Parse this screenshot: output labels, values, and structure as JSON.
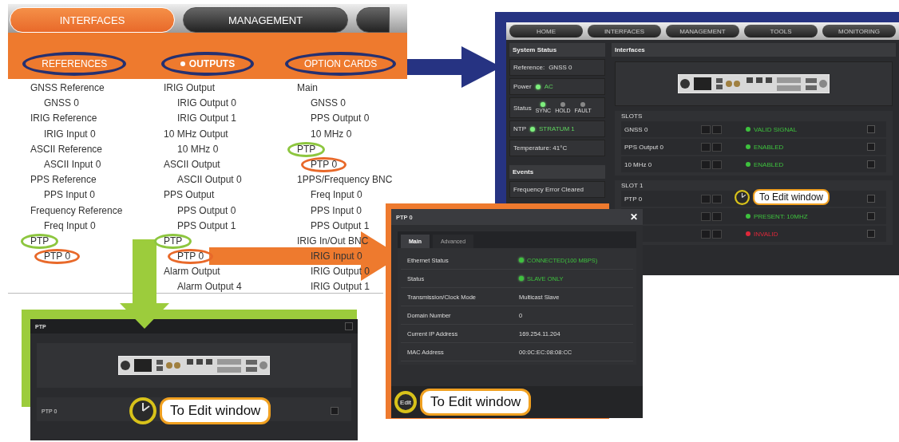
{
  "menu": {
    "tabs": [
      {
        "label": "INTERFACES",
        "selected": true
      },
      {
        "label": "MANAGEMENT",
        "selected": false
      }
    ],
    "categories": [
      {
        "label": "REFERENCES",
        "selected": false
      },
      {
        "label": "OUTPUTS",
        "selected": true
      },
      {
        "label": "OPTION CARDS",
        "selected": false
      }
    ],
    "columns": [
      {
        "items": [
          {
            "label": "GNSS Reference",
            "children": [
              {
                "label": "GNSS 0"
              }
            ]
          },
          {
            "label": "IRIG Reference",
            "children": [
              {
                "label": "IRIG Input 0"
              }
            ]
          },
          {
            "label": "ASCII Reference",
            "children": [
              {
                "label": "ASCII Input 0"
              }
            ]
          },
          {
            "label": "PPS Reference",
            "children": [
              {
                "label": "PPS Input 0"
              }
            ]
          },
          {
            "label": "Frequency Reference",
            "children": [
              {
                "label": "Freq Input 0"
              }
            ]
          },
          {
            "label": "PTP",
            "color": "#8dc63f",
            "children": [
              {
                "label": "PTP 0",
                "color": "#e8692a"
              }
            ]
          }
        ]
      },
      {
        "items": [
          {
            "label": "IRIG Output",
            "children": [
              {
                "label": "IRIG Output 0"
              },
              {
                "label": "IRIG Output 1"
              }
            ]
          },
          {
            "label": "10 MHz Output",
            "children": [
              {
                "label": "10 MHz 0"
              }
            ]
          },
          {
            "label": "ASCII Output",
            "children": [
              {
                "label": "ASCII Output 0"
              }
            ]
          },
          {
            "label": "PPS Output",
            "children": [
              {
                "label": "PPS Output 0"
              },
              {
                "label": "PPS Output 1"
              }
            ]
          },
          {
            "label": "PTP",
            "color": "#8dc63f",
            "children": [
              {
                "label": "PTP 0",
                "color": "#e8692a"
              }
            ]
          },
          {
            "label": "Alarm Output",
            "children": [
              {
                "label": "Alarm Output 4"
              }
            ]
          }
        ]
      },
      {
        "items": [
          {
            "label": "Main",
            "children": [
              {
                "label": "GNSS 0"
              },
              {
                "label": "PPS Output 0"
              },
              {
                "label": "10 MHz 0"
              }
            ]
          },
          {
            "label": "PTP",
            "color": "#8dc63f",
            "children": [
              {
                "label": "PTP 0",
                "color": "#e8692a"
              }
            ]
          },
          {
            "label": "1PPS/Frequency BNC",
            "children": [
              {
                "label": "Freq Input 0"
              },
              {
                "label": "PPS Input 0"
              },
              {
                "label": "PPS Output 1"
              }
            ]
          },
          {
            "label": "IRIG In/Out BNC",
            "children": [
              {
                "label": "IRIG Input 0"
              },
              {
                "label": "IRIG Output 0"
              },
              {
                "label": "IRIG Output 1"
              }
            ]
          }
        ]
      }
    ]
  },
  "dashboard": {
    "nav": [
      "HOME",
      "INTERFACES",
      "MANAGEMENT",
      "TOOLS",
      "MONITORING"
    ],
    "system_status": {
      "title": "System Status",
      "reference_label": "Reference:",
      "reference_value": "GNSS 0",
      "power_label": "Power",
      "power_value": "AC",
      "status_label": "Status",
      "leds": [
        {
          "label": "SYNC",
          "on": true
        },
        {
          "label": "HOLD",
          "on": false
        },
        {
          "label": "FAULT",
          "on": false
        }
      ],
      "ntp_label": "NTP",
      "ntp_value": "STRATUM 1",
      "temperature": "Temperature: 41°C"
    },
    "events": {
      "title": "Events",
      "items": [
        "Frequency Error Cleared"
      ]
    },
    "interfaces": {
      "title": "Interfaces",
      "groups": [
        {
          "label": "SLOTS",
          "rows": [
            {
              "name": "GNSS 0",
              "status": "VALID SIGNAL",
              "color": "#3ec23e"
            },
            {
              "name": "PPS Output 0",
              "status": "ENABLED",
              "color": "#3ec23e"
            },
            {
              "name": "10 MHz 0",
              "status": "ENABLED",
              "color": "#3ec23e"
            }
          ]
        },
        {
          "label": "SLOT 1",
          "rows": [
            {
              "name": "PTP 0"
            },
            {
              "status": "PRESENT: 10MHZ",
              "color": "#3ec23e"
            },
            {
              "status": "INVALID",
              "color": "#e0283a"
            }
          ]
        }
      ]
    },
    "callout": "To Edit window"
  },
  "ptp_window": {
    "title": "PTP 0",
    "close": "✕",
    "tabs": [
      {
        "label": "Main",
        "selected": true
      },
      {
        "label": "Advanced",
        "selected": false
      }
    ],
    "rows": [
      {
        "label": "Ethernet Status",
        "value": "CONNECTED(100 MBPS)",
        "color": "#3ec23e"
      },
      {
        "label": "Status",
        "value": "SLAVE ONLY",
        "color": "#3ec23e"
      },
      {
        "label": "Transmission/Clock Mode",
        "value": "Multicast Slave"
      },
      {
        "label": "Domain Number",
        "value": "0"
      },
      {
        "label": "Current IP Address",
        "value": "169.254.11.204"
      },
      {
        "label": "MAC Address",
        "value": "00:0C:EC:08:08:CC"
      }
    ],
    "edit_button": "Edit",
    "callout": "To Edit window"
  },
  "ptp_panel": {
    "title": "PTP",
    "row_label": "PTP 0",
    "callout": "To Edit window"
  }
}
